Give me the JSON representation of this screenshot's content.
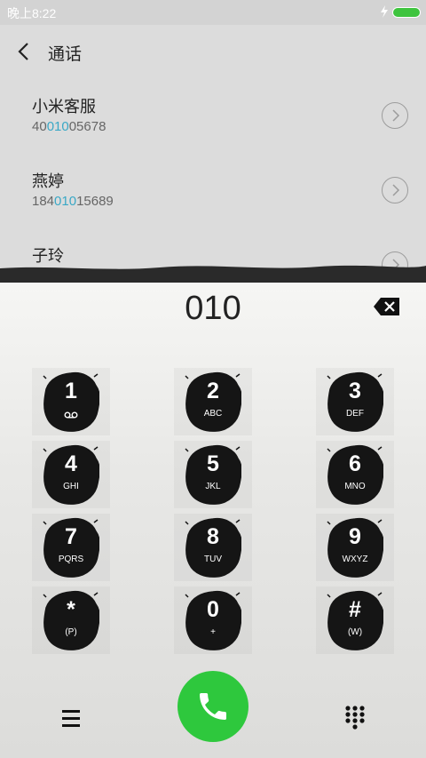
{
  "status_bar": {
    "time": "晚上8:22",
    "battery_color": "#3ec43e"
  },
  "header": {
    "title": "通话",
    "back_icon": "back-arrow-icon"
  },
  "contacts": [
    {
      "name": "小米客服",
      "number_pre": "40",
      "number_match": "010",
      "number_post": "05678"
    },
    {
      "name": "燕婷",
      "number_pre": "184",
      "number_match": "010",
      "number_post": "15689"
    },
    {
      "name": "子玲",
      "number_pre": "",
      "number_match": "",
      "number_post": ""
    }
  ],
  "dialer": {
    "input": "010",
    "backspace_icon": "backspace-icon"
  },
  "keypad": [
    {
      "main": "1",
      "sub": "voicemail-icon"
    },
    {
      "main": "2",
      "sub": "ABC"
    },
    {
      "main": "3",
      "sub": "DEF"
    },
    {
      "main": "4",
      "sub": "GHI"
    },
    {
      "main": "5",
      "sub": "JKL"
    },
    {
      "main": "6",
      "sub": "MNO"
    },
    {
      "main": "7",
      "sub": "PQRS"
    },
    {
      "main": "8",
      "sub": "TUV"
    },
    {
      "main": "9",
      "sub": "WXYZ"
    },
    {
      "main": "*",
      "sub": "(P)"
    },
    {
      "main": "0",
      "sub": "+"
    },
    {
      "main": "#",
      "sub": "(W)"
    }
  ],
  "bottom_bar": {
    "menu_icon": "menu-icon",
    "call_icon": "phone-icon",
    "call_color": "#2ec83d",
    "keypad_icon": "dialpad-icon"
  }
}
